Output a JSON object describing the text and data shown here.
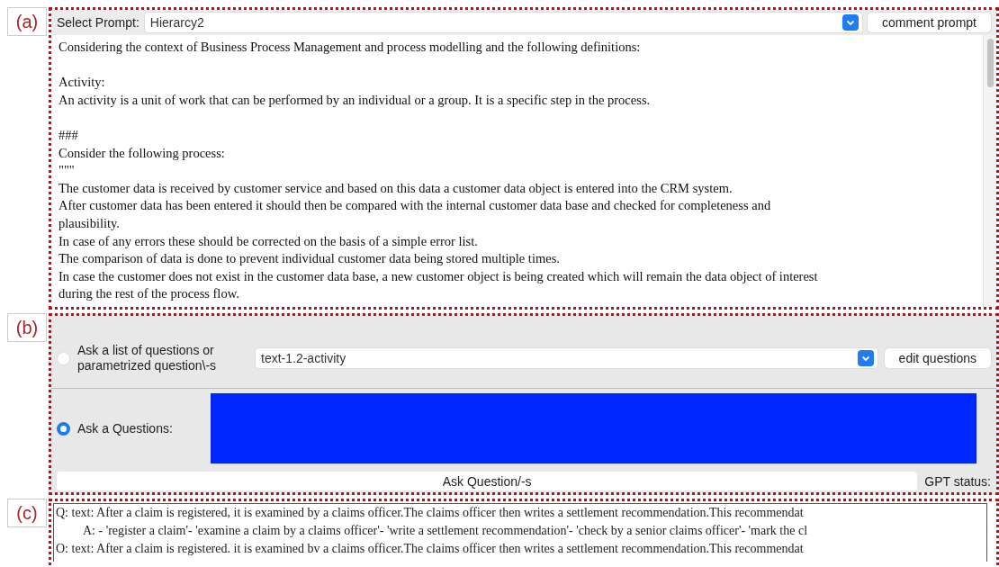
{
  "panels": [
    {
      "label": "(a)"
    },
    {
      "label": "(b)"
    },
    {
      "label": "(c)"
    }
  ],
  "prompt_bar": {
    "label": "Select Prompt:",
    "value": "Hierarcy2",
    "button": "comment prompt"
  },
  "prompt_text": [
    [
      "Considering the context of Business Process Management and process modelling and the following definitions:"
    ],
    [
      "Activity:",
      "An activity is a unit of work that can be performed by an individual or a group. It is a specific step in the process."
    ],
    [
      "###",
      "Consider the following process:",
      "\"\"\"",
      "The customer data is received by customer service and based on this data a customer data object is entered into the CRM system.",
      "After customer data has been entered it should then be compared with the internal customer data base and checked for completeness and",
      "plausibility.",
      "In case of any errors these should be corrected on the basis of a simple error list.",
      "The comparison of data is done to prevent individual customer data being stored multiple times.",
      "In case the customer does not exist in the customer data base, a new customer object is being created which will remain the data object of interest",
      "during the rest of the process flow."
    ]
  ],
  "question_modes": [
    {
      "label": "Ask a list of questions or parametrized question\\-s",
      "selected": false,
      "kind": "list",
      "value": "text-1.2-activity",
      "button": "edit questions"
    },
    {
      "label": "Ask a Questions:",
      "selected": true,
      "kind": "input"
    }
  ],
  "ask_button": "Ask Question/-s",
  "gpt_status": "GPT status:",
  "output_lines": [
    {
      "text": "Q: text: After a claim is registered, it is examined by a claims officer.The claims officer then writes a settlement recommendation.This recommendat",
      "indent": false
    },
    {
      "text": "A: - 'register a claim'- 'examine a claim by a claims officer'- 'write a settlement recommendation'- 'check by a senior claims officer'- 'mark the cl",
      "indent": true
    },
    {
      "text": "O: text: After a claim is registered. it is examined bv a claims officer.The claims officer then writes a settlement recommendation.This recommendat",
      "indent": false
    }
  ]
}
